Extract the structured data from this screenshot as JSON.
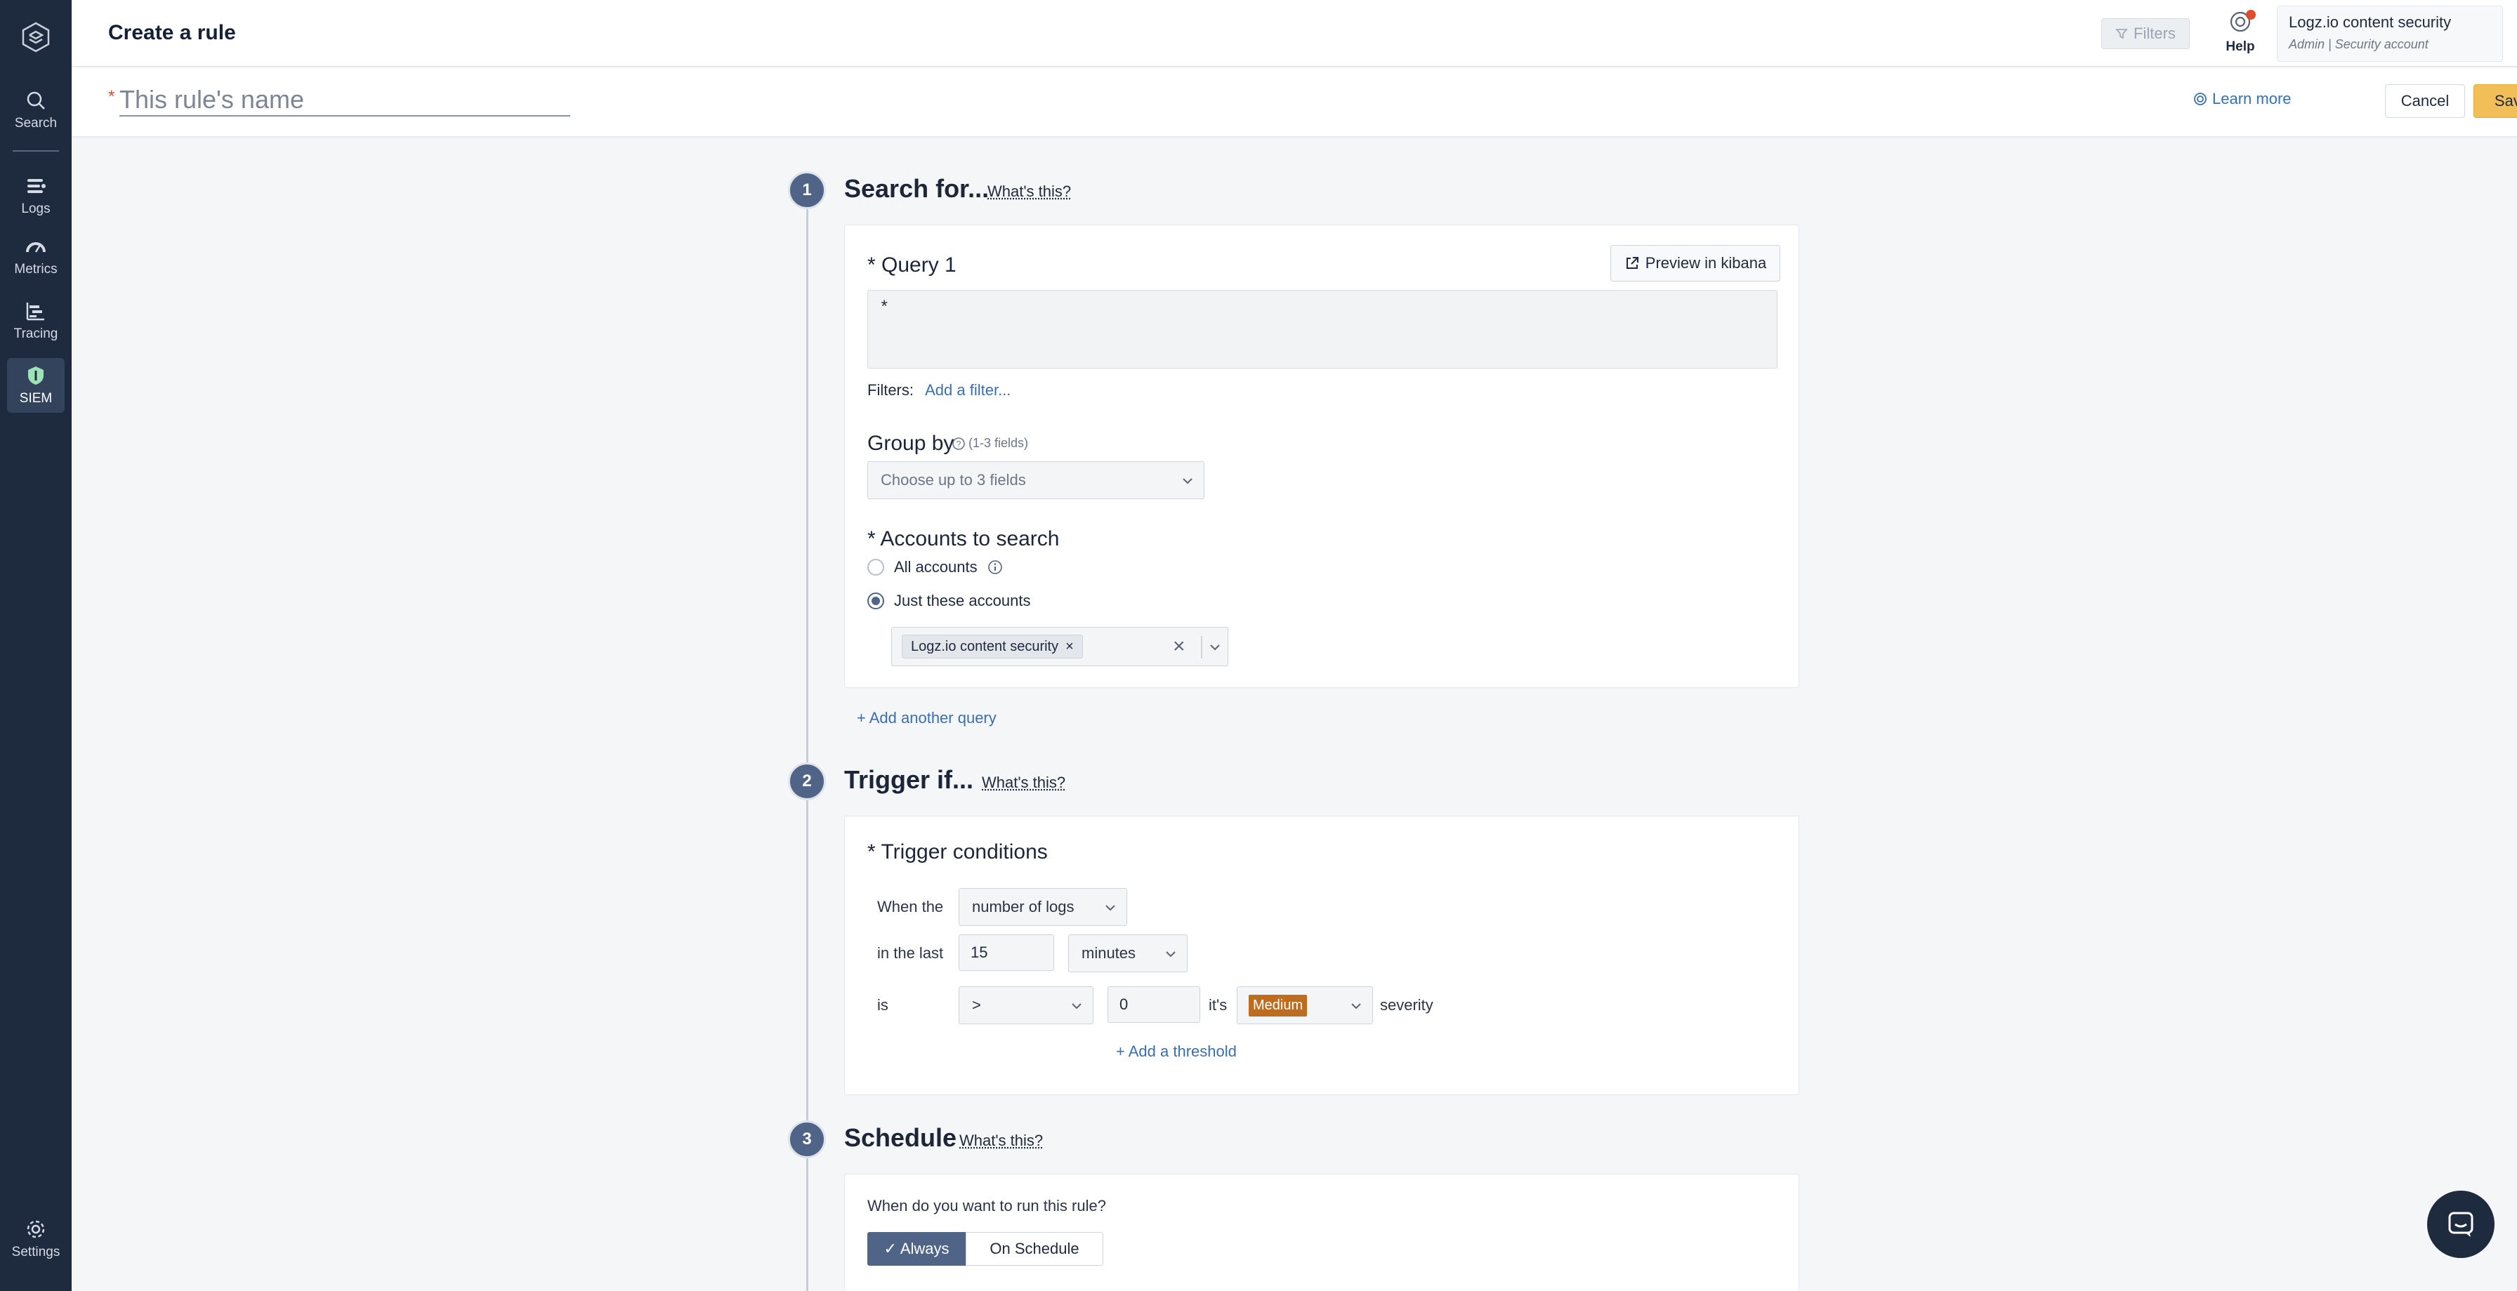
{
  "nav": {
    "items": [
      {
        "label": "Search",
        "icon": "search-icon"
      },
      {
        "label": "Logs",
        "icon": "logs-icon"
      },
      {
        "label": "Metrics",
        "icon": "metrics-icon"
      },
      {
        "label": "Tracing",
        "icon": "tracing-icon"
      },
      {
        "label": "SIEM",
        "icon": "shield-icon"
      }
    ],
    "settings_label": "Settings"
  },
  "header": {
    "title": "Create a rule",
    "filters_label": "Filters",
    "help_label": "Help",
    "account_name": "Logz.io content security",
    "account_role": "Admin  |  Security account"
  },
  "rule": {
    "name_placeholder": "This rule's name",
    "learn_more": "Learn more",
    "cancel": "Cancel",
    "save": "Save"
  },
  "steps": [
    {
      "number": "1",
      "title": "Search for...",
      "whats_this": "What's this?"
    },
    {
      "number": "2",
      "title": "Trigger if...",
      "whats_this": "What's this?"
    },
    {
      "number": "3",
      "title": "Schedule",
      "whats_this": "What's this?"
    }
  ],
  "search": {
    "query_label": "* Query 1",
    "preview_button": "Preview in kibana",
    "query_value": "*",
    "filters_label": "Filters:",
    "add_filter": "Add a filter...",
    "groupby_label": "Group by",
    "groupby_hint": "(1-3 fields)",
    "groupby_placeholder": "Choose up to 3 fields",
    "accounts_label": "* Accounts to search",
    "all_accounts": "All accounts",
    "just_these": "Just these accounts",
    "selected_account": "Logz.io content security",
    "add_query": "+ Add another query"
  },
  "trigger": {
    "conditions_label": "* Trigger conditions",
    "when_the": "When the",
    "metric": "number of logs",
    "in_the_last": "in the last",
    "period_value": "15",
    "period_unit": "minutes",
    "is_label": "is",
    "operator": ">",
    "threshold": "0",
    "its": "it's",
    "severity_value": "Medium",
    "severity_label": "severity",
    "add_threshold": "+ Add a threshold"
  },
  "schedule": {
    "question": "When do you want to run this rule?",
    "always": "✓ Always",
    "on_schedule": "On Schedule"
  },
  "colors": {
    "nav_bg": "#1e2a3e",
    "accent": "#4f6487",
    "save": "#f2be58",
    "medium": "#bc6d1f",
    "link": "#3a6fb0"
  }
}
